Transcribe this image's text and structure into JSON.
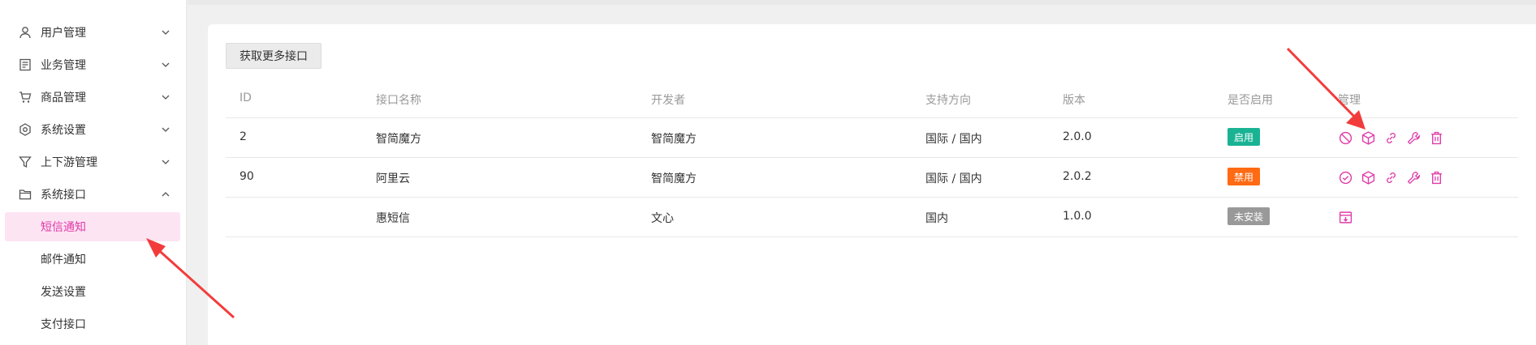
{
  "sidebar": {
    "items": [
      {
        "label": "用户管理",
        "icon": "user-icon",
        "expanded": false
      },
      {
        "label": "业务管理",
        "icon": "document-icon",
        "expanded": false
      },
      {
        "label": "商品管理",
        "icon": "cart-icon",
        "expanded": false
      },
      {
        "label": "系统设置",
        "icon": "hexagon-settings-icon",
        "expanded": false
      },
      {
        "label": "上下游管理",
        "icon": "filter-icon",
        "expanded": false
      },
      {
        "label": "系统接口",
        "icon": "folder-icon",
        "expanded": true
      }
    ],
    "sub_items": [
      {
        "label": "短信通知",
        "active": true
      },
      {
        "label": "邮件通知",
        "active": false
      },
      {
        "label": "发送设置",
        "active": false
      },
      {
        "label": "支付接口",
        "active": false
      }
    ]
  },
  "toolbar": {
    "get_more_label": "获取更多接口"
  },
  "table": {
    "headers": [
      "ID",
      "接口名称",
      "开发者",
      "支持方向",
      "版本",
      "是否启用",
      "管理"
    ],
    "rows": [
      {
        "id": "2",
        "name": "智简魔方",
        "developer": "智简魔方",
        "direction": "国际 / 国内",
        "version": "2.0.0",
        "status": "启用",
        "status_color": "#19b394"
      },
      {
        "id": "90",
        "name": "阿里云",
        "developer": "智简魔方",
        "direction": "国际 / 国内",
        "version": "2.0.2",
        "status": "禁用",
        "status_color": "#ff6a13"
      },
      {
        "id": "",
        "name": "惠短信",
        "developer": "文心",
        "direction": "国内",
        "version": "1.0.0",
        "status": "未安装",
        "status_color": "#999999"
      }
    ]
  },
  "colors": {
    "accent": "#e03aa8",
    "active_bg": "#fde4f3",
    "arrow": "#f23c3c"
  }
}
